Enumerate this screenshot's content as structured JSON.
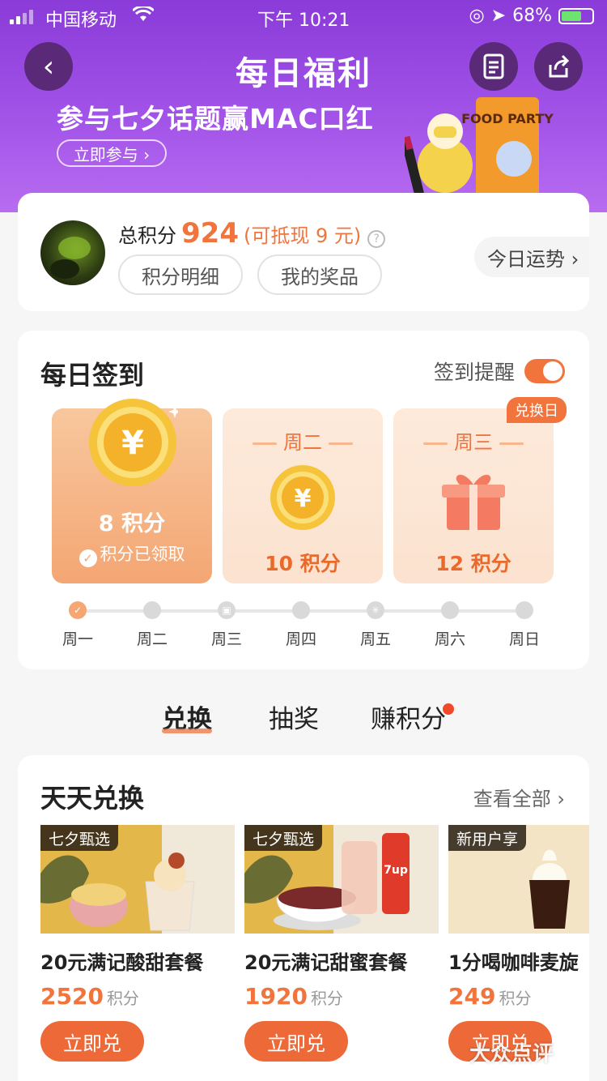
{
  "status_bar": {
    "carrier": "中国移动",
    "time": "下午 10:21",
    "battery": "68%"
  },
  "header": {
    "title": "每日福利",
    "promo_text": "参与七夕话题赢MAC口红",
    "join_label": "立即参与 ›",
    "banner_art_text": "FOOD PARTY"
  },
  "points": {
    "label": "总积分",
    "total": "924",
    "cash_note": "(可抵现 9 元)",
    "help": "?",
    "detail_label": "积分明细",
    "prize_label": "我的奖品",
    "fortune_label": "今日运势 ›"
  },
  "checkin": {
    "title": "每日签到",
    "reminder_label": "签到提醒",
    "reminder_on": true,
    "exchange_badge": "兑换日",
    "days": [
      {
        "points": "8 积分",
        "status": "积分已领取",
        "coin_symbol": "¥"
      },
      {
        "label": "周二",
        "points": "10 积分",
        "coin_symbol": "¥"
      },
      {
        "label": "周三",
        "points": "12 积分"
      }
    ],
    "week": [
      "周一",
      "周二",
      "周三",
      "周四",
      "周五",
      "周六",
      "周日"
    ],
    "week_done_count": 1
  },
  "tabs": [
    {
      "label": "兑换",
      "active": true
    },
    {
      "label": "抽奖",
      "active": false
    },
    {
      "label": "赚积分",
      "active": false,
      "has_dot": true
    }
  ],
  "exchange": {
    "title": "天天兑换",
    "view_all": "查看全部 ›",
    "unit": "积分",
    "redeem_label": "立即兑",
    "products": [
      {
        "tag": "七夕甄选",
        "name": "20元满记酸甜套餐",
        "price": "2520"
      },
      {
        "tag": "七夕甄选",
        "name": "20元满记甜蜜套餐",
        "price": "1920"
      },
      {
        "tag": "新用户享",
        "name": "1分喝咖啡麦旋",
        "price": "249"
      }
    ]
  },
  "watermark": "大众点评",
  "colors": {
    "accent": "#f2743d",
    "banner": "#a253e8",
    "tag_bg": "#2a1e14"
  }
}
